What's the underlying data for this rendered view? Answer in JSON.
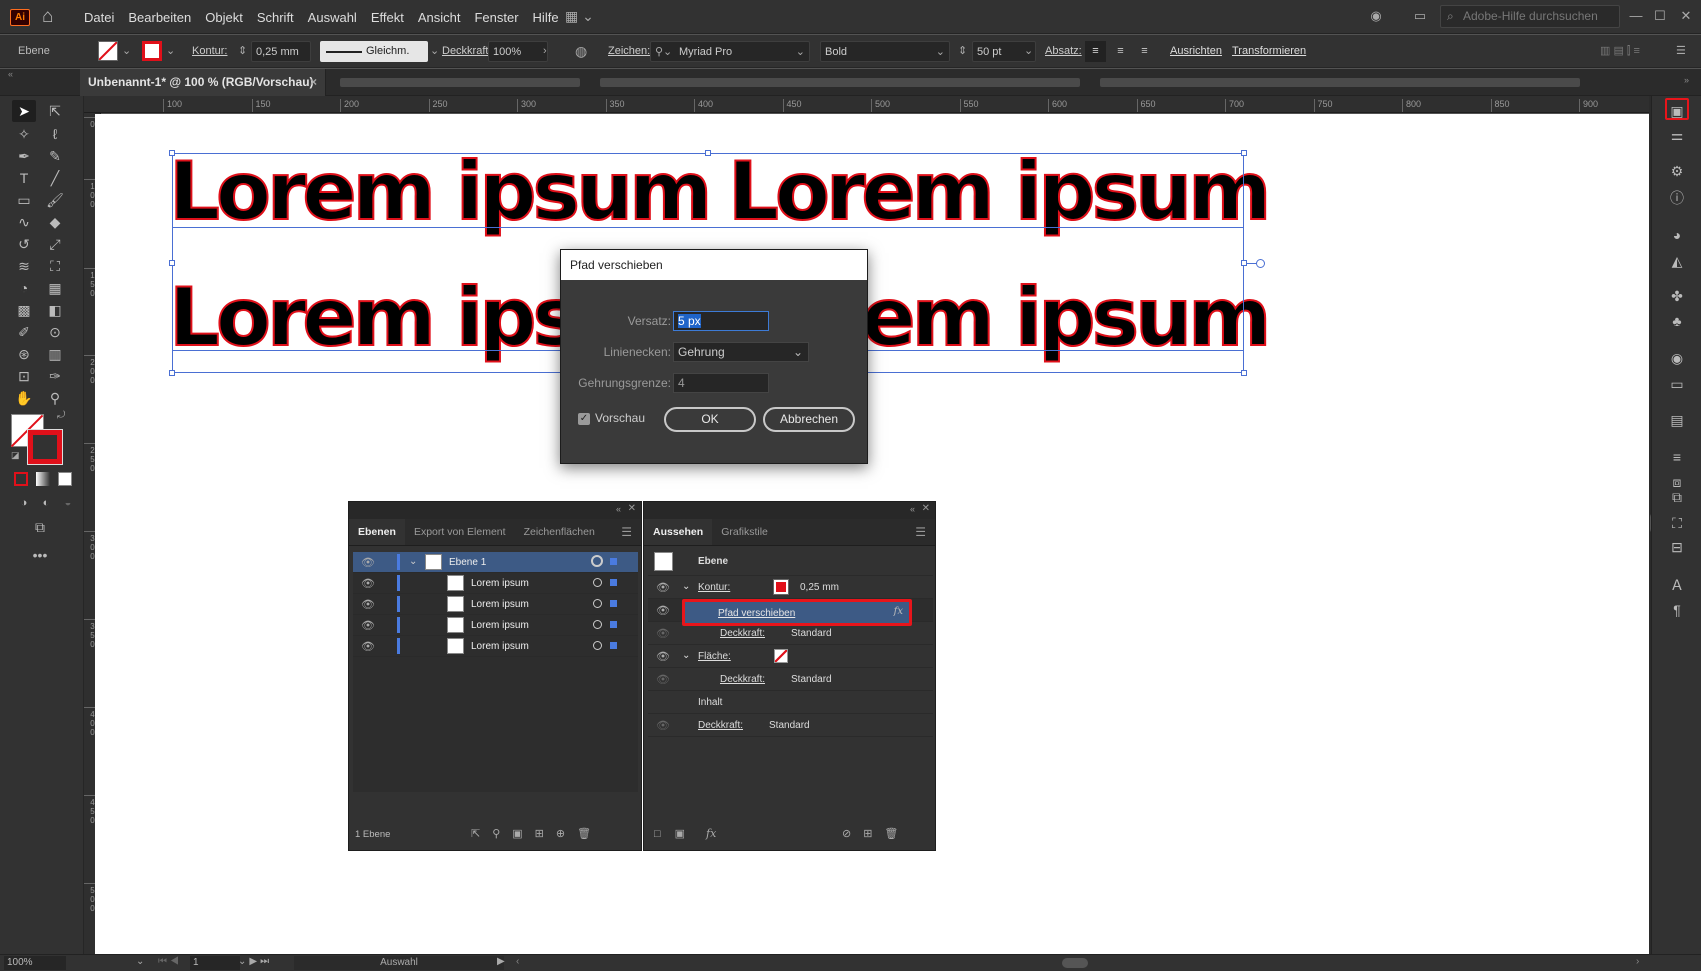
{
  "app": {
    "logo": "Ai"
  },
  "menu": [
    "Datei",
    "Bearbeiten",
    "Objekt",
    "Schrift",
    "Auswahl",
    "Effekt",
    "Ansicht",
    "Fenster",
    "Hilfe"
  ],
  "search": {
    "placeholder": "Adobe-Hilfe durchsuchen"
  },
  "control": {
    "selection_label": "Ebene",
    "kontur_label": "Kontur:",
    "kontur_value": "0,25 mm",
    "stroke_profile": "Gleichm.",
    "deckkraft_label": "Deckkraft:",
    "deckkraft_value": "100%",
    "zeichen_label": "Zeichen:",
    "font_family": "Myriad Pro",
    "font_style": "Bold",
    "font_size": "50 pt",
    "absatz_label": "Absatz:",
    "ausrichten": "Ausrichten",
    "transformieren": "Transformieren"
  },
  "doc_tab": {
    "title": "Unbenannt-1* @ 100 % (RGB/Vorschau)",
    "close": "×"
  },
  "ruler": {
    "top": [
      "100",
      "150",
      "200",
      "250",
      "300",
      "350",
      "400",
      "450",
      "500",
      "550",
      "600",
      "650",
      "700",
      "750",
      "800",
      "850",
      "900"
    ],
    "left": [
      "0",
      "1 0 0",
      "1 5 0",
      "2 0 0",
      "2 5 0",
      "3 0 0",
      "3 5 0",
      "4 0 0",
      "4 5 0",
      "5 0 0"
    ]
  },
  "canvas": {
    "text": "Lorem ipsum"
  },
  "dialog": {
    "title": "Pfad verschieben",
    "versatz_label": "Versatz:",
    "versatz_value": "5 px",
    "linienecken_label": "Linienecken:",
    "linienecken_value": "Gehrung",
    "gehrungsgrenze_label": "Gehrungsgrenze:",
    "gehrungsgrenze_value": "4",
    "preview_label": "Vorschau",
    "ok": "OK",
    "cancel": "Abbrechen"
  },
  "layers_panel": {
    "tabs": [
      "Ebenen",
      "Export von Element",
      "Zeichenflächen"
    ],
    "rows": [
      {
        "name": "Ebene 1"
      },
      {
        "name": "Lorem ipsum"
      },
      {
        "name": "Lorem ipsum"
      },
      {
        "name": "Lorem ipsum"
      },
      {
        "name": "Lorem ipsum"
      }
    ],
    "footer": "1 Ebene"
  },
  "appearance_panel": {
    "tabs": [
      "Aussehen",
      "Grafikstile"
    ],
    "header": "Ebene",
    "kontur_label": "Kontur:",
    "kontur_value": "0,25 mm",
    "effect_name": "Pfad verschieben",
    "fx": "fx",
    "deckkraft_label": "Deckkraft:",
    "deckkraft_value": "Standard",
    "flaeche_label": "Fläche:",
    "inhalt": "Inhalt"
  },
  "status": {
    "zoom": "100%",
    "artboard": "1",
    "tool": "Auswahl"
  },
  "colors": {
    "stroke_red": "#e0101a",
    "selection_blue": "#4a6fd3",
    "highlight_red": "#e8151b"
  }
}
